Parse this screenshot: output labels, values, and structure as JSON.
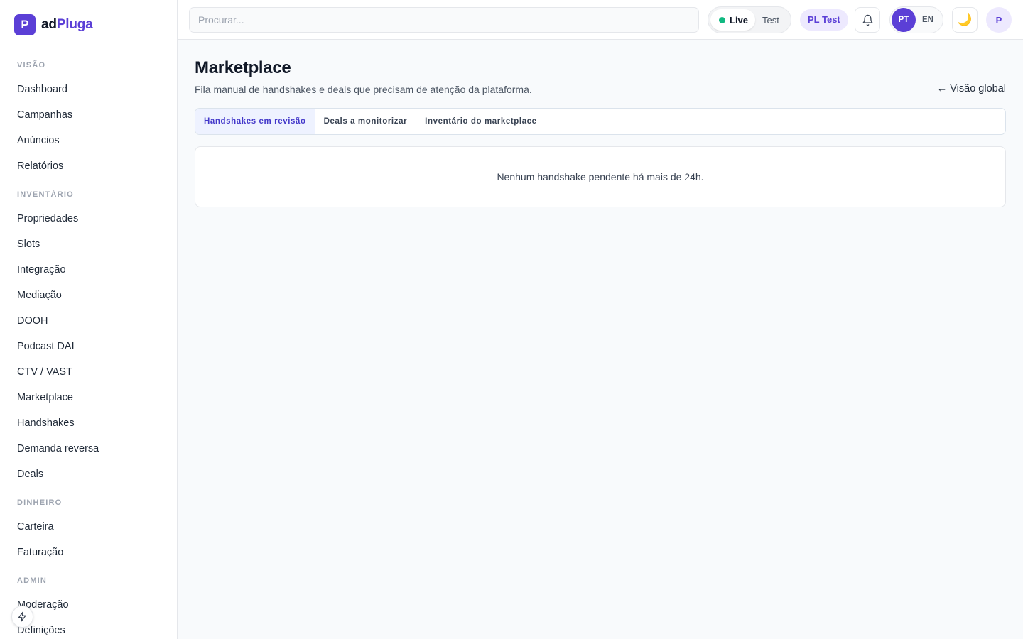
{
  "brand": {
    "logo_letter": "P",
    "name_prefix": "ad",
    "name_accent": "Pluga"
  },
  "sidebar": {
    "sections": [
      {
        "title": "VISÃO",
        "items": [
          "Dashboard",
          "Campanhas",
          "Anúncios",
          "Relatórios"
        ]
      },
      {
        "title": "INVENTÁRIO",
        "items": [
          "Propriedades",
          "Slots",
          "Integração",
          "Mediação",
          "DOOH",
          "Podcast DAI",
          "CTV / VAST",
          "Marketplace",
          "Handshakes",
          "Demanda reversa",
          "Deals"
        ]
      },
      {
        "title": "DINHEIRO",
        "items": [
          "Carteira",
          "Faturação"
        ]
      },
      {
        "title": "ADMIN",
        "items": [
          "Moderação",
          "Definições"
        ]
      }
    ]
  },
  "topbar": {
    "search_placeholder": "Procurar...",
    "env_live": "Live",
    "env_test": "Test",
    "tenant": "PL Test",
    "lang_active": "PT",
    "lang_other": "EN",
    "avatar_letter": "P",
    "theme_icon": "moon-icon"
  },
  "main": {
    "title": "Marketplace",
    "subtitle": "Fila manual de handshakes e deals que precisam de atenção da plataforma.",
    "back_link": "← Visão global",
    "tabs": [
      "Handshakes em revisão",
      "Deals a monitorizar",
      "Inventário do marketplace"
    ],
    "active_tab": 0,
    "empty_message": "Nenhum handshake pendente há mais de 24h."
  },
  "colors": {
    "accent": "#5b3fd6",
    "live": "#10b981",
    "tab_active_bg": "#eef2ff"
  }
}
